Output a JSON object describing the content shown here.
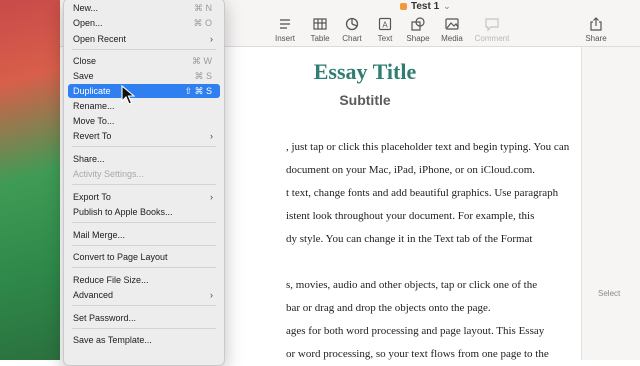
{
  "window": {
    "doc_title": "Test 1",
    "toolbar": [
      {
        "label": "Insert",
        "icon": "insert-icon",
        "enabled": true
      },
      {
        "label": "Table",
        "icon": "table-icon",
        "enabled": true
      },
      {
        "label": "Chart",
        "icon": "chart-icon",
        "enabled": true
      },
      {
        "label": "Text",
        "icon": "text-icon",
        "enabled": true
      },
      {
        "label": "Shape",
        "icon": "shape-icon",
        "enabled": true
      },
      {
        "label": "Media",
        "icon": "media-icon",
        "enabled": true
      },
      {
        "label": "Comment",
        "icon": "comment-icon",
        "enabled": false
      },
      {
        "label": "Share",
        "icon": "share-icon",
        "enabled": true
      }
    ],
    "sidebar_hint": "Select"
  },
  "document": {
    "title": "Essay Title",
    "subtitle": "Subtitle",
    "lines": [
      ", just tap or click this placeholder text and begin typing. You can",
      "document on your Mac, iPad, iPhone, or on iCloud.com.",
      "t text, change fonts and add beautiful graphics. Use paragraph",
      "istent look throughout your document. For example, this",
      "dy style. You can change it in the Text tab of the Format",
      "s, movies, audio and other objects, tap or click one of the",
      "bar or drag and drop the objects onto the page.",
      "ages for both word processing and page layout. This Essay",
      "or word processing, so your text flows from one page to the"
    ]
  },
  "file_menu": {
    "items": [
      {
        "label": "New...",
        "shortcut": "⌘ N"
      },
      {
        "label": "Open...",
        "shortcut": "⌘ O"
      },
      {
        "label": "Open Recent",
        "submenu": true
      },
      {
        "separator": true
      },
      {
        "label": "Close",
        "shortcut": "⌘ W"
      },
      {
        "label": "Save",
        "shortcut": "⌘ S"
      },
      {
        "label": "Duplicate",
        "shortcut": "⇧ ⌘ S",
        "highlighted": true
      },
      {
        "label": "Rename..."
      },
      {
        "label": "Move To..."
      },
      {
        "label": "Revert To",
        "submenu": true
      },
      {
        "separator": true
      },
      {
        "label": "Share..."
      },
      {
        "label": "Activity Settings...",
        "disabled": true
      },
      {
        "separator": true
      },
      {
        "label": "Export To",
        "submenu": true
      },
      {
        "label": "Publish to Apple Books..."
      },
      {
        "separator": true
      },
      {
        "label": "Mail Merge..."
      },
      {
        "separator": true
      },
      {
        "label": "Convert to Page Layout"
      },
      {
        "separator": true
      },
      {
        "label": "Reduce File Size..."
      },
      {
        "label": "Advanced",
        "submenu": true
      },
      {
        "separator": true
      },
      {
        "label": "Set Password..."
      },
      {
        "separator": true
      },
      {
        "label": "Save as Template..."
      }
    ]
  }
}
